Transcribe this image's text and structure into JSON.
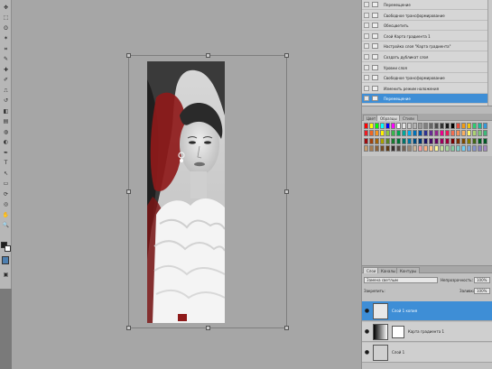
{
  "history": {
    "rows": [
      {
        "label": "Перемещение",
        "active": false
      },
      {
        "label": "Свободное трансформирование",
        "active": false
      },
      {
        "label": "Обесцветить",
        "active": false
      },
      {
        "label": "Слой Карта градиента 1",
        "active": false
      },
      {
        "label": "Настройка слоя \"Карта градиента\"",
        "active": false
      },
      {
        "label": "Создать дубликат слоя",
        "active": false
      },
      {
        "label": "Уровни слоя",
        "active": false
      },
      {
        "label": "Свободное трансформирование",
        "active": false
      },
      {
        "label": "Изменить режим наложения",
        "active": false
      },
      {
        "label": "Перемещение",
        "active": true
      }
    ]
  },
  "swatches_panel": {
    "tabs": [
      "Цвет",
      "Образцы",
      "Стили"
    ],
    "active_tab": 1,
    "rows": [
      [
        "#ff0000",
        "#ffff00",
        "#00ff00",
        "#00ffff",
        "#0000ff",
        "#ff00ff",
        "#ffffff",
        "#e6e6e6",
        "#cccccc",
        "#b3b3b3",
        "#999999",
        "#808080",
        "#666666",
        "#4d4d4d",
        "#333333",
        "#1a1a1a",
        "#000000",
        "#e84c3d",
        "#f39c12",
        "#f1c40f",
        "#2ecc71",
        "#1abc9c",
        "#3498db"
      ],
      [
        "#ed1c24",
        "#f26522",
        "#f7941d",
        "#fff200",
        "#8dc63f",
        "#39b54a",
        "#00a651",
        "#00a99d",
        "#00aeef",
        "#0072bc",
        "#0054a6",
        "#2e3192",
        "#662d91",
        "#92278f",
        "#ec008c",
        "#ed145b",
        "#f26c4f",
        "#f68e56",
        "#fbaf5d",
        "#fff568",
        "#acd373",
        "#7cc576",
        "#3cb878"
      ],
      [
        "#9e0b0f",
        "#a0410d",
        "#a3620a",
        "#aba000",
        "#598527",
        "#197b30",
        "#007236",
        "#00746b",
        "#0076a3",
        "#004a80",
        "#003471",
        "#1b1464",
        "#440e62",
        "#630460",
        "#9e005d",
        "#9e0039",
        "#790000",
        "#7b2e00",
        "#7d4900",
        "#827b00",
        "#406618",
        "#005e20",
        "#005826"
      ],
      [
        "#c69c6d",
        "#a67c52",
        "#8c6239",
        "#754c24",
        "#603913",
        "#362f2d",
        "#534741",
        "#736357",
        "#998675",
        "#c7b299",
        "#f5989d",
        "#f9ad81",
        "#fdc68a",
        "#fff79a",
        "#c4df9b",
        "#a3d39c",
        "#82ca9d",
        "#7accc8",
        "#6dcff6",
        "#7da7d9",
        "#8393ca",
        "#8781bd",
        "#a186be"
      ]
    ]
  },
  "layers": {
    "tabs": [
      "Слои",
      "Каналы",
      "Контуры"
    ],
    "active_tab": 0,
    "blend_mode": "Замена светлым",
    "opacity_label": "Непрозрачность:",
    "opacity_value": "100%",
    "lock_label": "Закрепить:",
    "fill_label": "Заливка:",
    "fill_value": "100%",
    "items": [
      {
        "name": "Слой 1 копия",
        "selected": true
      },
      {
        "name": "Карта градиента 1",
        "selected": false
      },
      {
        "name": "Слой 1",
        "selected": false
      }
    ]
  },
  "toolbar": {
    "icons": [
      "move-icon",
      "marquee-icon",
      "lasso-icon",
      "magic-wand-icon",
      "crop-icon",
      "eyedropper-icon",
      "healing-icon",
      "brush-icon",
      "stamp-icon",
      "history-brush-icon",
      "eraser-icon",
      "gradient-icon",
      "blur-icon",
      "dodge-icon",
      "pen-icon",
      "type-icon",
      "path-select-icon",
      "shape-icon",
      "3d-rotate-icon",
      "3d-camera-icon",
      "hand-icon",
      "zoom-icon"
    ],
    "glyphs": [
      "✥",
      "⬚",
      "ʘ",
      "✶",
      "⌗",
      "✎",
      "✚",
      "✐",
      "⎍",
      "↺",
      "◧",
      "▤",
      "◍",
      "◐",
      "✒",
      "T",
      "↖",
      "▭",
      "⟳",
      "◎",
      "✋",
      "🔍"
    ],
    "foreground_color": "#1e1e1e",
    "background_color": "#ffffff",
    "quick_mask_color": "#4d7fb0"
  }
}
